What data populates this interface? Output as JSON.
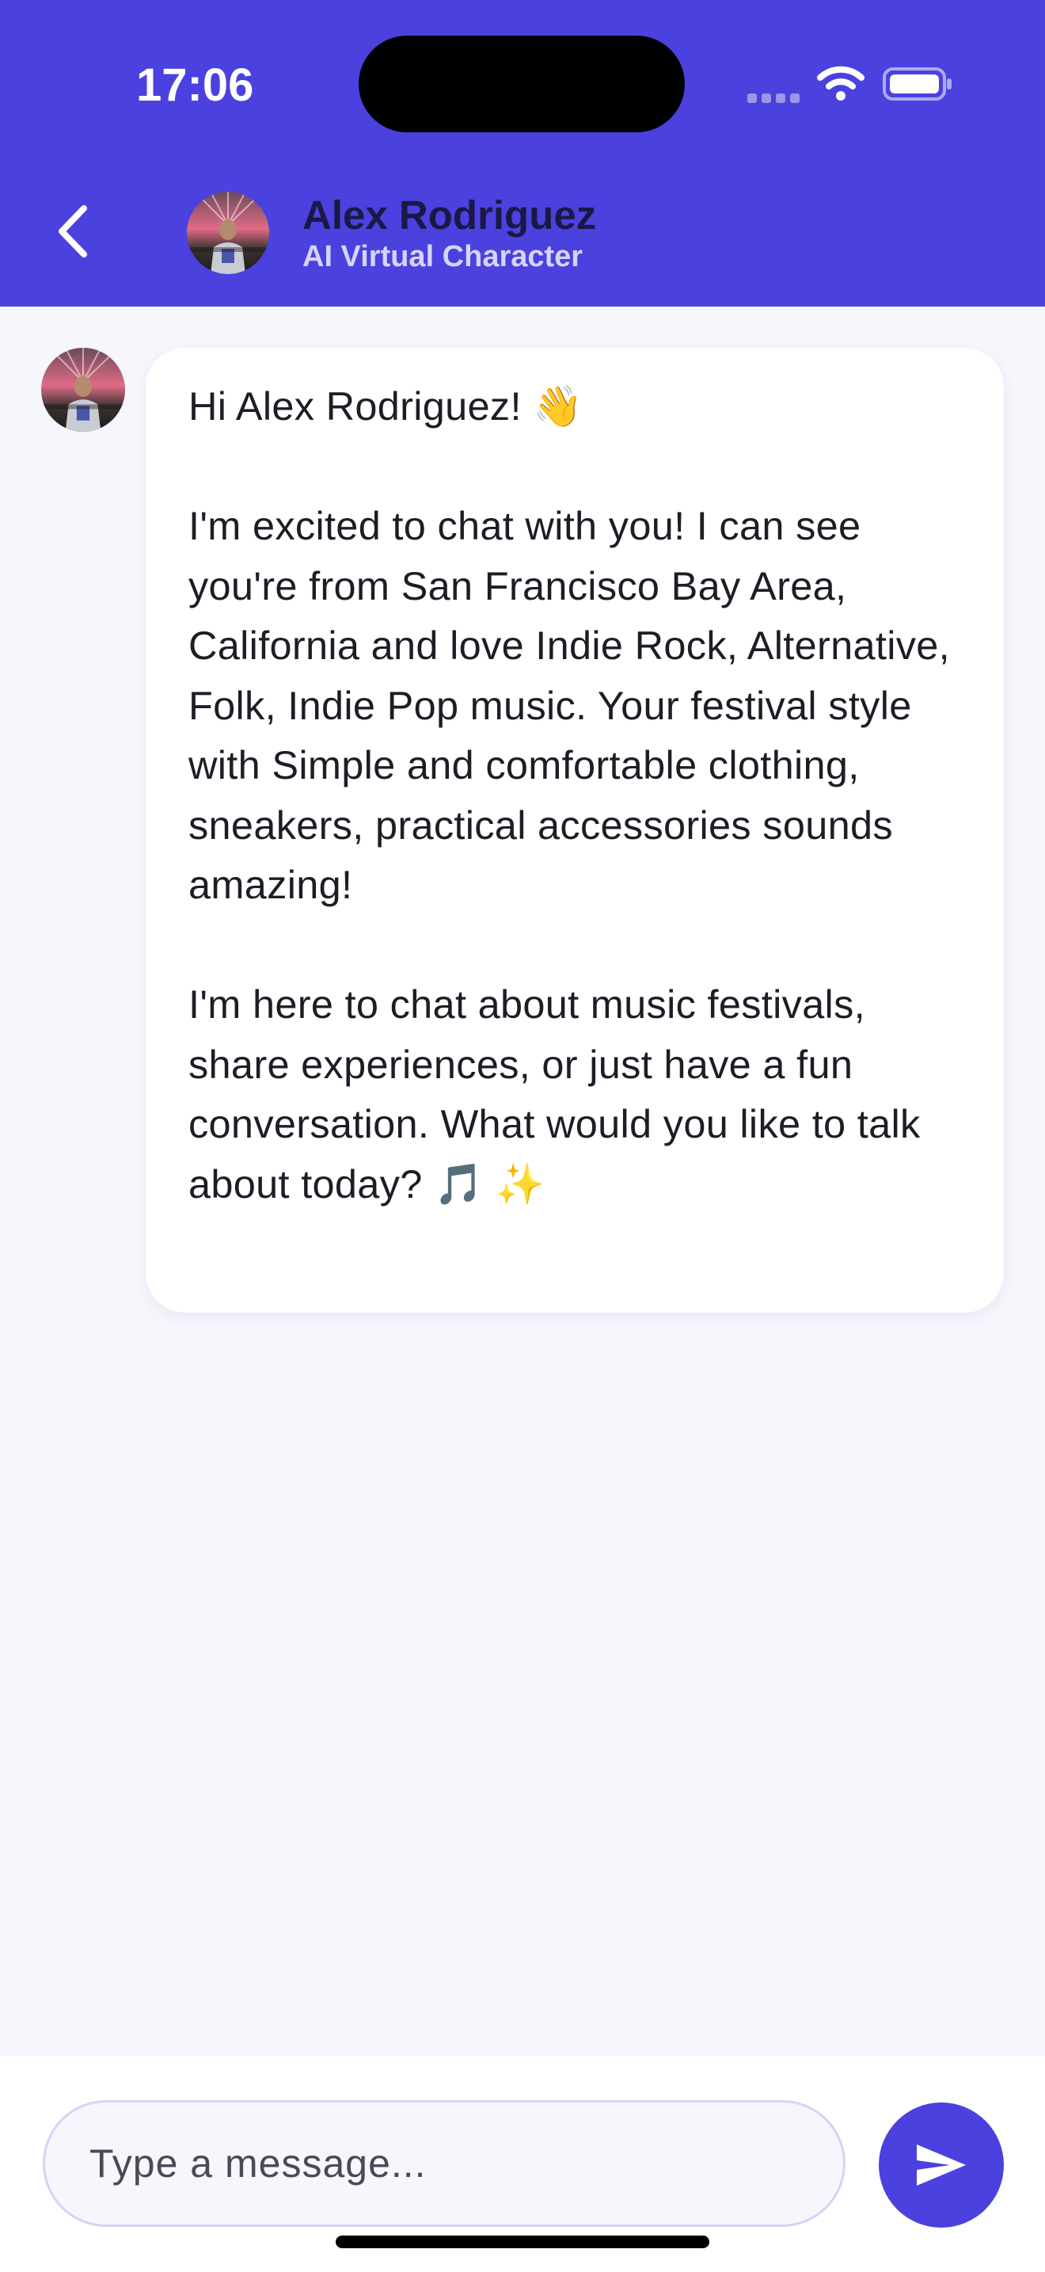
{
  "status_bar": {
    "time": "17:06"
  },
  "header": {
    "back_icon": "chevron-left-icon",
    "name": "Alex Rodriguez",
    "subtitle": "AI Virtual Character"
  },
  "chat": {
    "messages": [
      {
        "sender": "character",
        "text": "Hi Alex Rodriguez! 👋\n\nI'm excited to chat with you! I can see you're from San Francisco Bay Area, California and love Indie Rock, Alternative, Folk, Indie Pop music. Your festival style with Simple and comfortable clothing, sneakers, practical accessories sounds amazing!\n\nI'm here to chat about music festivals, share experiences, or just have a fun conversation. What would you like to talk about today? 🎵 ✨"
      }
    ]
  },
  "composer": {
    "placeholder": "Type a message...",
    "value": "",
    "send_icon": "send-icon"
  },
  "colors": {
    "accent": "#4b41df",
    "background": "#f6f6fd",
    "bubble": "#ffffff",
    "name_text": "#1a1946",
    "subtitle_text": "#d6d4fb"
  }
}
